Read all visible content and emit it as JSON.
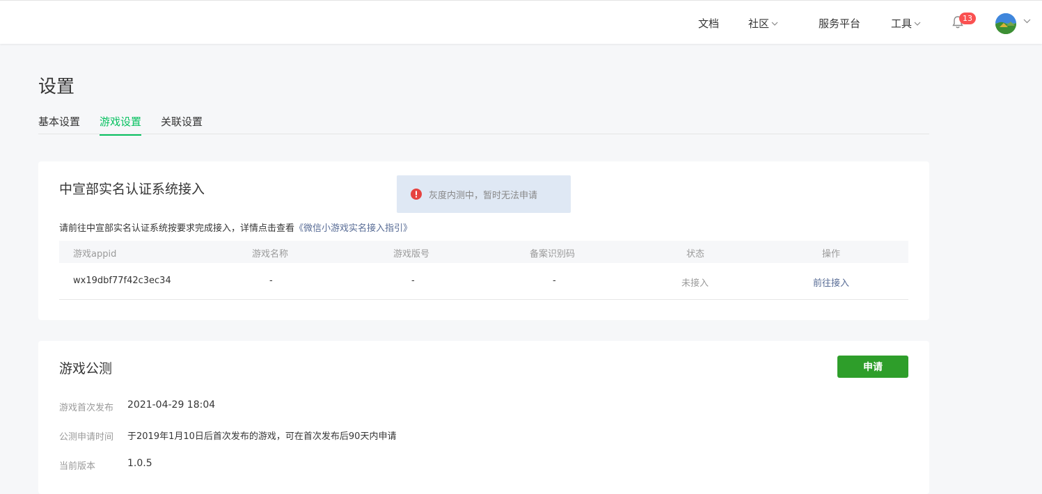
{
  "topnav": {
    "docs": "文档",
    "community": "社区",
    "service_platform": "服务平台",
    "tools": "工具",
    "notification_count": "13"
  },
  "page": {
    "title": "设置",
    "tabs": [
      "基本设置",
      "游戏设置",
      "关联设置"
    ],
    "active_tab": "游戏设置"
  },
  "realname": {
    "title": "中宣部实名认证系统接入",
    "toast": "灰度内测中，暂时无法申请",
    "desc": "请前往中宣部实名认证系统按要求完成接入，详情点击查看",
    "desc_link": "《微信小游戏实名接入指引》",
    "columns": [
      "游戏appid",
      "游戏名称",
      "游戏版号",
      "备案识别码",
      "状态",
      "操作"
    ],
    "row": {
      "appid": "wx19dbf77f42c3ec34",
      "name": "-",
      "license": "-",
      "record_code": "-",
      "status": "未接入",
      "action": "前往接入"
    }
  },
  "public_test": {
    "title": "游戏公测",
    "apply_label": "申请",
    "fields": [
      {
        "label": "游戏首次发布",
        "value": "2021-04-29 18:04"
      },
      {
        "label": "公测申请时间",
        "value": "于2019年1月10日后首次发布的游戏，可在首次发布后90天内申请"
      },
      {
        "label": "当前版本",
        "value": "1.0.5"
      }
    ]
  },
  "colors": {
    "accent_green": "#07c160",
    "button_green": "#2e9e2a",
    "link_blue": "#576b95",
    "badge_red": "#fa5151",
    "error_red": "#e64340"
  },
  "icons": [
    "chevron-down-icon",
    "bell-icon",
    "avatar",
    "error-icon"
  ]
}
